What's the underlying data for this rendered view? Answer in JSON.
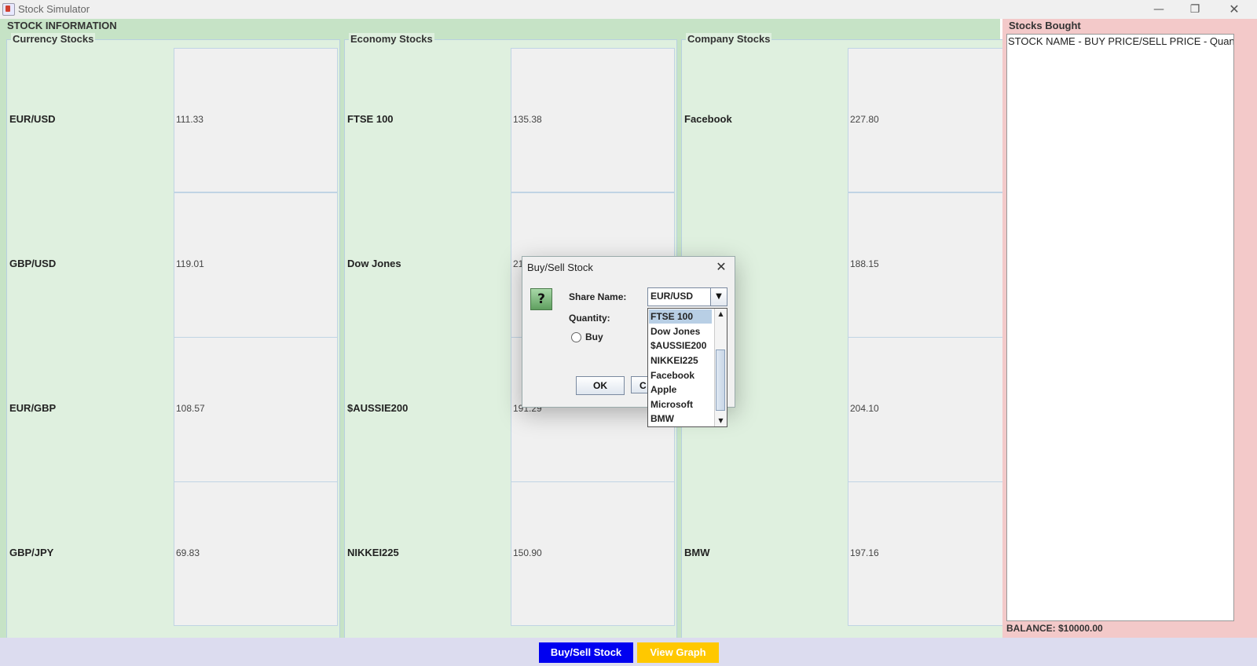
{
  "window": {
    "title": "Stock Simulator"
  },
  "stock_info": {
    "heading": "STOCK INFORMATION",
    "groups": [
      {
        "label": "Currency Stocks",
        "rows": [
          {
            "name": "EUR/USD",
            "price": "111.33"
          },
          {
            "name": "GBP/USD",
            "price": "119.01"
          },
          {
            "name": "EUR/GBP",
            "price": "108.57"
          },
          {
            "name": "GBP/JPY",
            "price": "69.83"
          }
        ]
      },
      {
        "label": "Economy Stocks",
        "rows": [
          {
            "name": "FTSE 100",
            "price": "135.38"
          },
          {
            "name": "Dow Jones",
            "price": "21"
          },
          {
            "name": "$AUSSIE200",
            "price": "191.29"
          },
          {
            "name": "NIKKEI225",
            "price": "150.90"
          }
        ]
      },
      {
        "label": "Company Stocks",
        "rows": [
          {
            "name": "Facebook",
            "price": "227.80"
          },
          {
            "name": "",
            "price": "188.15"
          },
          {
            "name": "",
            "price": "204.10"
          },
          {
            "name": "BMW",
            "price": "197.16"
          }
        ]
      }
    ]
  },
  "stocks_bought": {
    "heading": "Stocks Bought",
    "list_header": "STOCK NAME - BUY PRICE/SELL PRICE - Quantity",
    "balance": "BALANCE: $10000.00"
  },
  "bottom_bar": {
    "buysell_label": "Buy/Sell Stock",
    "graph_label": "View Graph"
  },
  "dialog": {
    "title": "Buy/Sell Stock",
    "share_name_label": "Share Name:",
    "quantity_label": "Quantity:",
    "buy_label": "Buy",
    "ok_label": "OK",
    "cancel_label": "C",
    "selected_share": "EUR/USD",
    "options": [
      "FTSE 100",
      "Dow Jones",
      "$AUSSIE200",
      "NIKKEI225",
      "Facebook",
      "Apple",
      "Microsoft",
      "BMW"
    ]
  },
  "colors": {
    "stock_info_bg": "#c6e3c6",
    "stocks_bought_bg": "#f3c9c9",
    "buysell_button": "#0000f0",
    "graph_button": "#ffc800"
  },
  "icons": {
    "question": "question-icon",
    "close": "close-icon",
    "dropdown": "chevron-down-icon"
  }
}
